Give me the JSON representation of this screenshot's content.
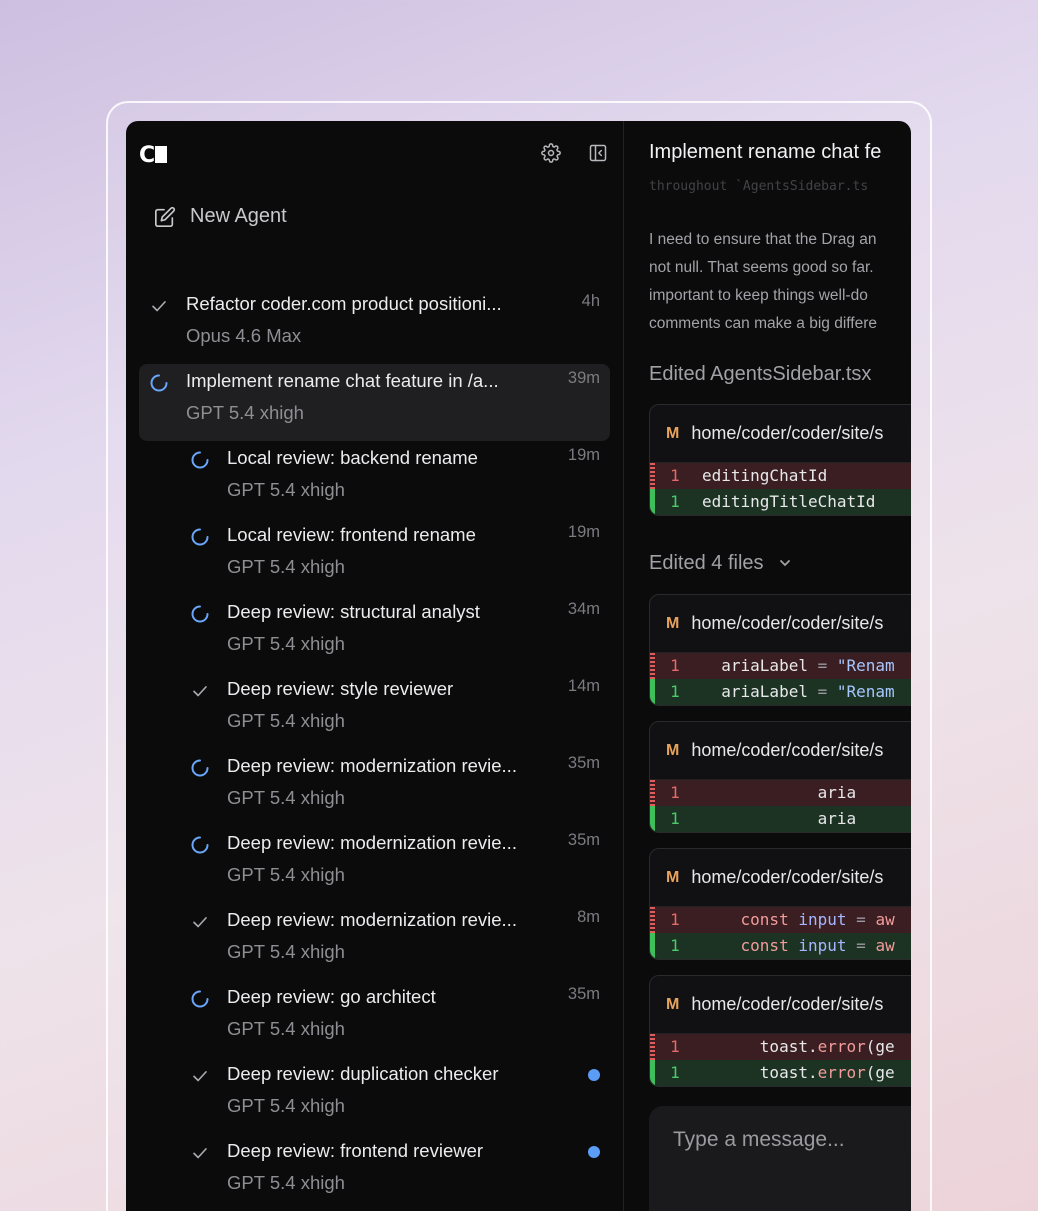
{
  "app": {
    "logo": "C",
    "settings_icon": "gear-icon",
    "collapse_icon": "sidebar-collapse-icon"
  },
  "sidebar": {
    "new_agent_label": "New Agent",
    "chats": [
      {
        "status": "done",
        "level": 0,
        "title": "Refactor coder.com product positioni...",
        "model": "Opus 4.6 Max",
        "time": "4h"
      },
      {
        "status": "running",
        "level": 0,
        "active": true,
        "title": "Implement rename chat feature in /a...",
        "model": "GPT 5.4 xhigh",
        "time": "39m"
      },
      {
        "status": "running",
        "level": 1,
        "title": "Local review: backend rename",
        "model": "GPT 5.4 xhigh",
        "time": "19m"
      },
      {
        "status": "running",
        "level": 1,
        "title": "Local review: frontend rename",
        "model": "GPT 5.4 xhigh",
        "time": "19m"
      },
      {
        "status": "running",
        "level": 1,
        "title": "Deep review: structural analyst",
        "model": "GPT 5.4 xhigh",
        "time": "34m"
      },
      {
        "status": "done",
        "level": 1,
        "title": "Deep review: style reviewer",
        "model": "GPT 5.4 xhigh",
        "time": "14m"
      },
      {
        "status": "running",
        "level": 1,
        "title": "Deep review: modernization revie...",
        "model": "GPT 5.4 xhigh",
        "time": "35m"
      },
      {
        "status": "running",
        "level": 1,
        "title": "Deep review: modernization revie...",
        "model": "GPT 5.4 xhigh",
        "time": "35m"
      },
      {
        "status": "done",
        "level": 1,
        "title": "Deep review: modernization revie...",
        "model": "GPT 5.4 xhigh",
        "time": "8m"
      },
      {
        "status": "running",
        "level": 1,
        "title": "Deep review: go architect",
        "model": "GPT 5.4 xhigh",
        "time": "35m"
      },
      {
        "status": "done",
        "level": 1,
        "title": "Deep review: duplication checker",
        "model": "GPT 5.4 xhigh",
        "time": "",
        "unread": true
      },
      {
        "status": "done",
        "level": 1,
        "title": "Deep review: frontend reviewer",
        "model": "GPT 5.4 xhigh",
        "time": "",
        "unread": true
      }
    ]
  },
  "main": {
    "title": "Implement rename chat fe",
    "faded_line": "throughout `AgentsSidebar.ts",
    "paragraph": [
      "I need to ensure that the Drag an",
      "not null. That seems good so far.",
      "important to keep things well-do",
      "comments can make a big differe"
    ],
    "edited_single_label": "Edited AgentsSidebar.tsx",
    "edited_multi_label": "Edited 4 files",
    "diff_marker": "M",
    "diffs": [
      {
        "path": "home/coder/coder/site/s",
        "del_num": "1",
        "add_num": "1",
        "del_code": "editingChatId",
        "add_code": "editingTitleChatId"
      },
      {
        "path": "home/coder/coder/site/s",
        "del_num": "1",
        "add_num": "1",
        "indent": "  ",
        "prop": "ariaLabel",
        "eq": "=",
        "str": "\"Renam"
      },
      {
        "path": "home/coder/coder/site/s",
        "del_num": "1",
        "add_num": "1",
        "indent": "            ",
        "code": "aria"
      },
      {
        "path": "home/coder/coder/site/s",
        "del_num": "1",
        "add_num": "1",
        "indent": "    ",
        "kw": "const",
        "var": "input",
        "eq": "=",
        "rest": "aw"
      },
      {
        "path": "home/coder/coder/site/s",
        "del_num": "1",
        "add_num": "1",
        "indent": "      ",
        "code": "toast.",
        "fn": "error",
        "rest": "(ge"
      }
    ],
    "composer_placeholder": "Type a message..."
  }
}
